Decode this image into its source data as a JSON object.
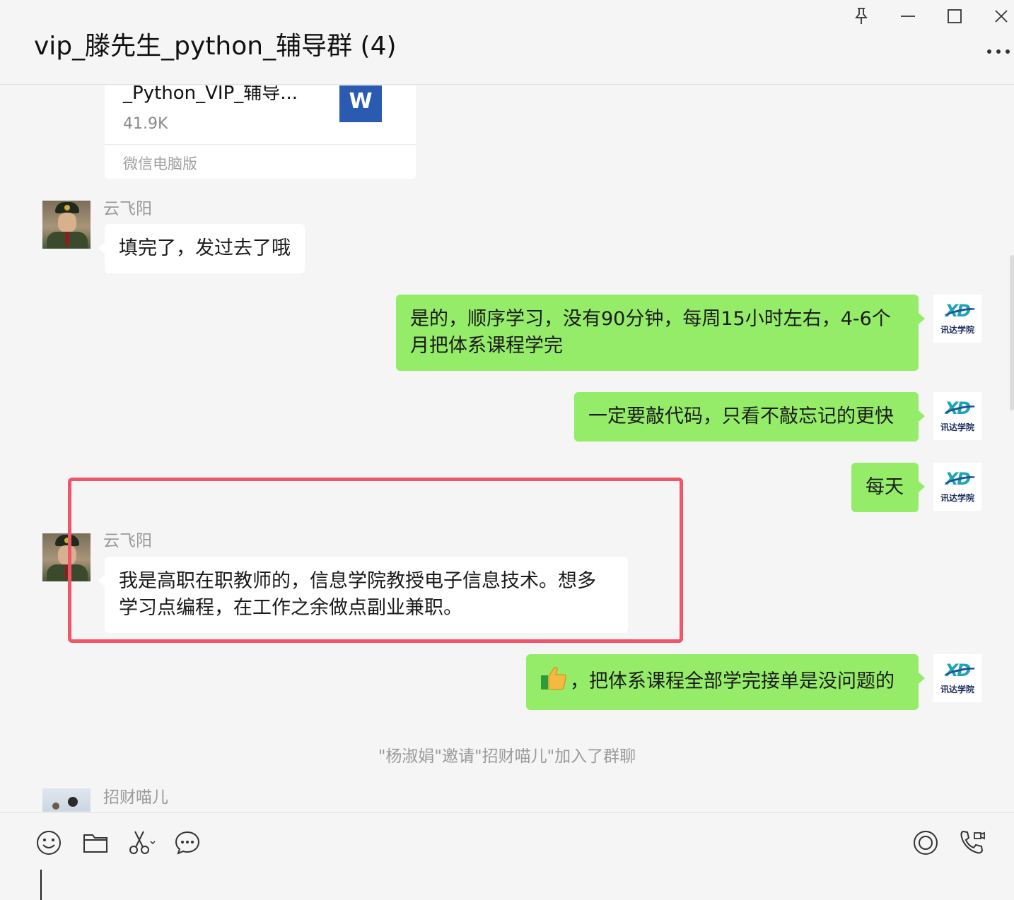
{
  "window": {
    "title": "vip_滕先生_python_辅导群 (4)"
  },
  "file_message": {
    "name": "_Python_VIP_辅导...",
    "size": "41.9K",
    "icon_letter": "W",
    "source": "微信电脑版"
  },
  "messages": [
    {
      "direction": "in",
      "sender": "云飞阳",
      "text": "填完了，发过去了哦"
    },
    {
      "direction": "out",
      "text_line1": "是的，顺序学习，没有90分钟，每周15小时左右，4-6个",
      "text_line2": "月把体系课程学完"
    },
    {
      "direction": "out",
      "text": "一定要敲代码，只看不敲忘记的更快"
    },
    {
      "direction": "out",
      "text": "每天"
    },
    {
      "direction": "in",
      "sender": "云飞阳",
      "text_line1": "我是高职在职教师的，信息学院教授电子信息技术。想多",
      "text_line2": "学习点编程，在工作之余做点副业兼职。"
    },
    {
      "direction": "out",
      "text": "，把体系课程全部学完接单是没问题的",
      "emoji": "thumbs-up-icon"
    }
  ],
  "avatars": {
    "self_brand": "讯达学院",
    "self_logo_text": "XD"
  },
  "system_message": "\"杨淑娟\"邀请\"招财喵儿\"加入了群聊",
  "last_sender": "招财喵儿",
  "colors": {
    "outgoing_bubble": "#95ec69",
    "incoming_bubble": "#ffffff",
    "highlight_border": "#f0566a",
    "background": "#f5f5f5"
  }
}
